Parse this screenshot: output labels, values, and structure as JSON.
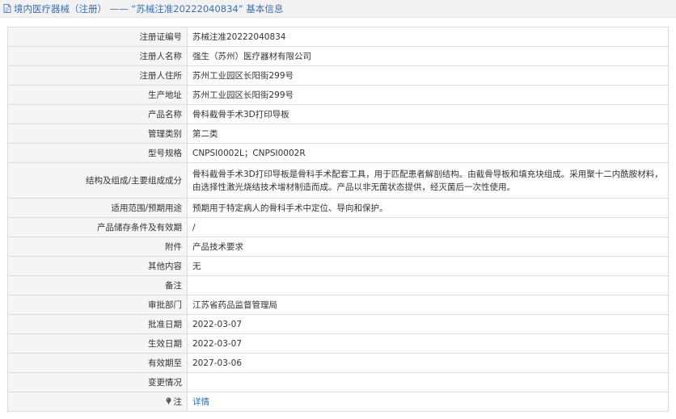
{
  "header": {
    "icon": "document-icon",
    "title": "境内医疗器械（注册） —— “苏械注准20222040834” 基本信息"
  },
  "table": {
    "rows": [
      {
        "label": "注册证编号",
        "value": "苏械注准20222040834"
      },
      {
        "label": "注册人名称",
        "value": "强生（苏州）医疗器材有限公司"
      },
      {
        "label": "注册人住所",
        "value": "苏州工业园区长阳街299号"
      },
      {
        "label": "生产地址",
        "value": "苏州工业园区长阳街299号"
      },
      {
        "label": "产品名称",
        "value": "骨科截骨手术3D打印导板"
      },
      {
        "label": "管理类别",
        "value": "第二类"
      },
      {
        "label": "型号规格",
        "value": "CNPSI0002L；CNPSI0002R"
      },
      {
        "label": "结构及组成/主要组成成分",
        "value": "骨科截骨手术3D打印导板是骨科手术配套工具，用于匹配患者解剖结构。由截骨导板和填充块组成。采用聚十二内酰胺材料，由选择性激光烧结技术增材制造而成。产品以非无菌状态提供，经灭菌后一次性使用。"
      },
      {
        "label": "适用范围/预期用途",
        "value": "预期用于特定病人的骨科手术中定位、导向和保护。"
      },
      {
        "label": "产品储存条件及有效期",
        "value": "/"
      },
      {
        "label": "附件",
        "value": "产品技术要求"
      },
      {
        "label": "其他内容",
        "value": "无"
      },
      {
        "label": "备注",
        "value": ""
      },
      {
        "label": "审批部门",
        "value": "江苏省药品监督管理局"
      },
      {
        "label": "批准日期",
        "value": "2022-03-07"
      },
      {
        "label": "生效日期",
        "value": "2022-03-07"
      },
      {
        "label": "有效期至",
        "value": "2027-03-06"
      },
      {
        "label": "变更情况",
        "value": ""
      },
      {
        "label": "注",
        "label_icon": "pin-note-icon",
        "value": "详情"
      }
    ]
  },
  "colors": {
    "title": "#3d6fb6",
    "link": "#2b6fc4",
    "label_bg": "#f5f5f5",
    "border": "#dcdcdc",
    "header_bg": "#f2f2f2"
  }
}
